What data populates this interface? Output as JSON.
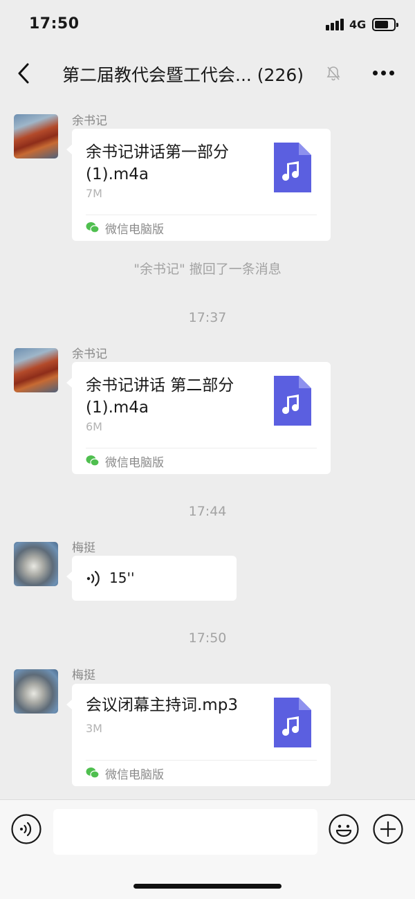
{
  "status_bar": {
    "time": "17:50",
    "network": "4G",
    "battery_level": 0.65
  },
  "nav": {
    "title": "第二届教代会暨工代会... (226)",
    "icons": {
      "back": "chevron-left-icon",
      "mute": "bell-muted-icon",
      "more": "more-dots-icon"
    }
  },
  "messages": [
    {
      "type": "file",
      "sender": "余书记",
      "file_name": "余书记讲话第一部分(1).m4a",
      "file_size": "7M",
      "source": "微信电脑版",
      "file_icon": "music-file-icon"
    },
    {
      "type": "system",
      "text": "\"余书记\" 撤回了一条消息"
    },
    {
      "type": "time",
      "text": "17:37"
    },
    {
      "type": "file",
      "sender": "余书记",
      "file_name": "余书记讲话 第二部分(1).m4a",
      "file_size": "6M",
      "source": "微信电脑版",
      "file_icon": "music-file-icon"
    },
    {
      "type": "time",
      "text": "17:44"
    },
    {
      "type": "voice",
      "sender": "梅挺",
      "duration": "15''"
    },
    {
      "type": "time",
      "text": "17:50"
    },
    {
      "type": "file",
      "sender": "梅挺",
      "file_name": "会议闭幕主持词.mp3",
      "file_size": "3M",
      "source": "微信电脑版",
      "file_icon": "music-file-icon"
    }
  ],
  "input_bar": {
    "icons": {
      "voice": "voice-input-icon",
      "emoji": "emoji-icon",
      "plus": "plus-icon"
    },
    "placeholder": ""
  },
  "colors": {
    "file_icon": "#5b5fe0",
    "background": "#ededed",
    "wechat_green": "#4fbf4f"
  }
}
